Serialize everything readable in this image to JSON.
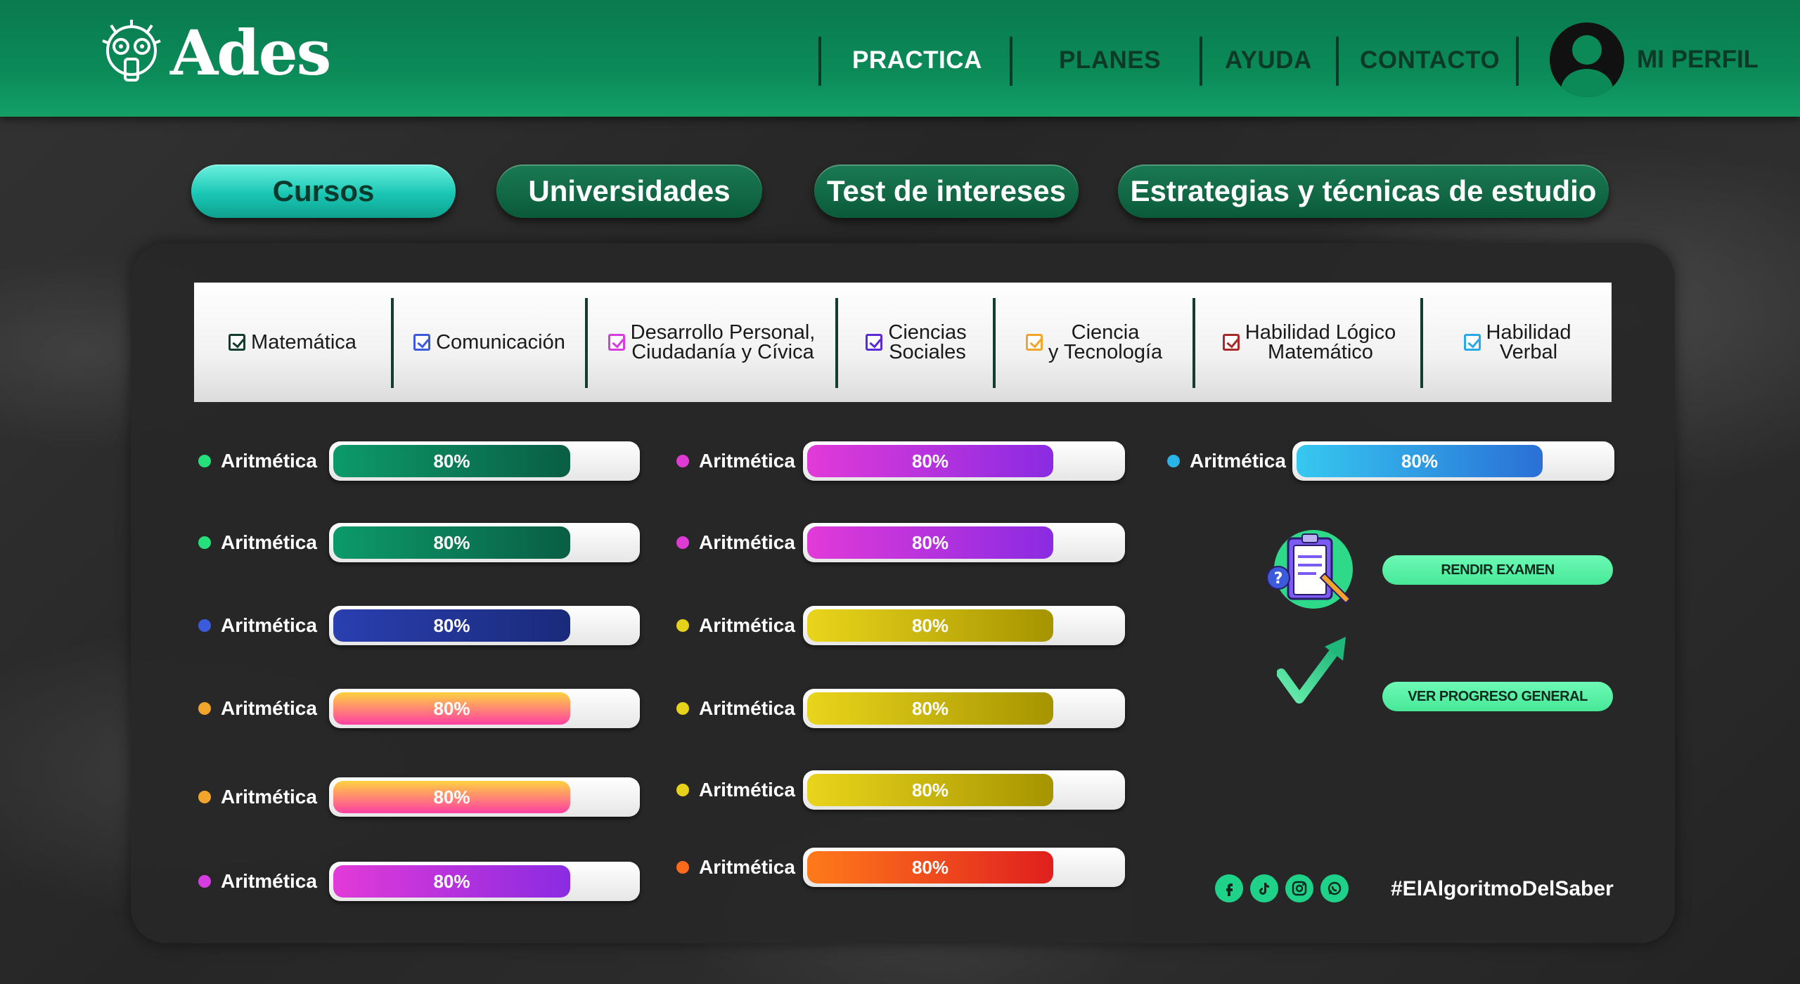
{
  "brand": {
    "name": "Ades"
  },
  "nav": {
    "items": [
      "PRACTICA",
      "PLANES",
      "AYUDA",
      "CONTACTO"
    ],
    "active": "PRACTICA",
    "profile": "MI PERFIL"
  },
  "tabs": [
    "Cursos",
    "Universidades",
    "Test de intereses",
    "Estrategias y técnicas de estudio"
  ],
  "active_tab": "Cursos",
  "courses": [
    {
      "line1": "Matemática",
      "line2": "",
      "color": "#143d30",
      "checked": true
    },
    {
      "line1": "Comunicación",
      "line2": "",
      "color": "#3b5bdb",
      "checked": true
    },
    {
      "line1": "Desarrollo Personal,",
      "line2": "Ciudadanía y Cívica",
      "color": "#d63de0",
      "checked": true
    },
    {
      "line1": "Ciencias",
      "line2": "Sociales",
      "color": "#5a2bd6",
      "checked": true
    },
    {
      "line1": "Ciencia",
      "line2": "y Tecnología",
      "color": "#f2a52b",
      "checked": true
    },
    {
      "line1": "Habilidad Lógico",
      "line2": "Matemático",
      "color": "#a82a2a",
      "checked": true
    },
    {
      "line1": "Habilidad",
      "line2": "Verbal",
      "color": "#29a9e6",
      "checked": true
    }
  ],
  "progress": {
    "col1": [
      {
        "label": "Aritmética",
        "value": "80%",
        "dot": "#25e07a",
        "fill": [
          "#0c9a6a",
          "#0a5e44"
        ]
      },
      {
        "label": "Aritmética",
        "value": "80%",
        "dot": "#25e07a",
        "fill": [
          "#0c9a6a",
          "#0a5e44"
        ]
      },
      {
        "label": "Aritmética",
        "value": "80%",
        "dot": "#3b5bdb",
        "fill": [
          "#2a3fb0",
          "#1a2a7a"
        ]
      },
      {
        "label": "Aritmética",
        "value": "80%",
        "dot": "#f2a52b",
        "fill": [
          "#ffd23f",
          "#ff3fa4"
        ]
      },
      {
        "label": "Aritmética",
        "value": "80%",
        "dot": "#f2a52b",
        "fill": [
          "#ffd23f",
          "#ff3fa4"
        ]
      },
      {
        "label": "Aritmética",
        "value": "80%",
        "dot": "#d63de0",
        "fill": [
          "#e23ad8",
          "#8a2be2"
        ]
      }
    ],
    "col2": [
      {
        "label": "Aritmética",
        "value": "80%",
        "dot": "#e03ad4",
        "fill": [
          "#e23ad8",
          "#8a2be2"
        ]
      },
      {
        "label": "Aritmética",
        "value": "80%",
        "dot": "#e03ad4",
        "fill": [
          "#e23ad8",
          "#8a2be2"
        ]
      },
      {
        "label": "Aritmética",
        "value": "80%",
        "dot": "#e6d21a",
        "fill": [
          "#e9d51c",
          "#a69400"
        ]
      },
      {
        "label": "Aritmética",
        "value": "80%",
        "dot": "#e6d21a",
        "fill": [
          "#e9d51c",
          "#a69400"
        ]
      },
      {
        "label": "Aritmética",
        "value": "80%",
        "dot": "#e6d21a",
        "fill": [
          "#e9d51c",
          "#a69400"
        ]
      },
      {
        "label": "Aritmética",
        "value": "80%",
        "dot": "#ff6a1a",
        "fill": [
          "#ff7a1a",
          "#e01f1f"
        ]
      }
    ],
    "col3": [
      {
        "label": "Aritmética",
        "value": "80%",
        "dot": "#29b3e6",
        "fill": [
          "#36c8f0",
          "#2a6fd6"
        ]
      }
    ]
  },
  "actions": {
    "exam": "RENDIR EXAMEN",
    "progress": "VER PROGRESO GENERAL"
  },
  "footer": {
    "social": [
      "facebook-icon",
      "tiktok-icon",
      "instagram-icon",
      "whatsapp-icon"
    ],
    "hashtag": "#ElAlgoritmoDelSaber"
  }
}
